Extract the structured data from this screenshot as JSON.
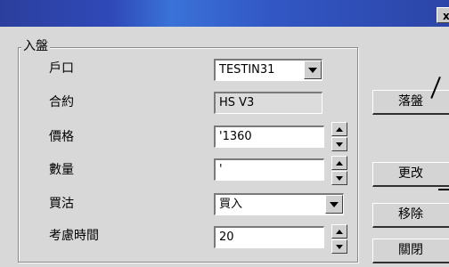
{
  "window": {
    "close_label": "x"
  },
  "group": {
    "title": "入盤"
  },
  "fields": {
    "account": {
      "label": "戶口",
      "value": "TESTIN31"
    },
    "contract": {
      "label": "合約",
      "value": "HS V3"
    },
    "price": {
      "label": "價格",
      "value": "'1360"
    },
    "quantity": {
      "label": "數量",
      "value": "'"
    },
    "side": {
      "label": "買沽",
      "value": "買入"
    },
    "consider_time": {
      "label": "考慮時間",
      "value": "20"
    }
  },
  "buttons": {
    "place_order": "落盤",
    "modify": "更改",
    "remove": "移除",
    "close": "關閉"
  },
  "colors": {
    "title_bar": "#2f49b8",
    "window_bg": "#d8d8d8",
    "field_bg": "#ffffff",
    "readonly_bg": "#dcdcdc"
  }
}
